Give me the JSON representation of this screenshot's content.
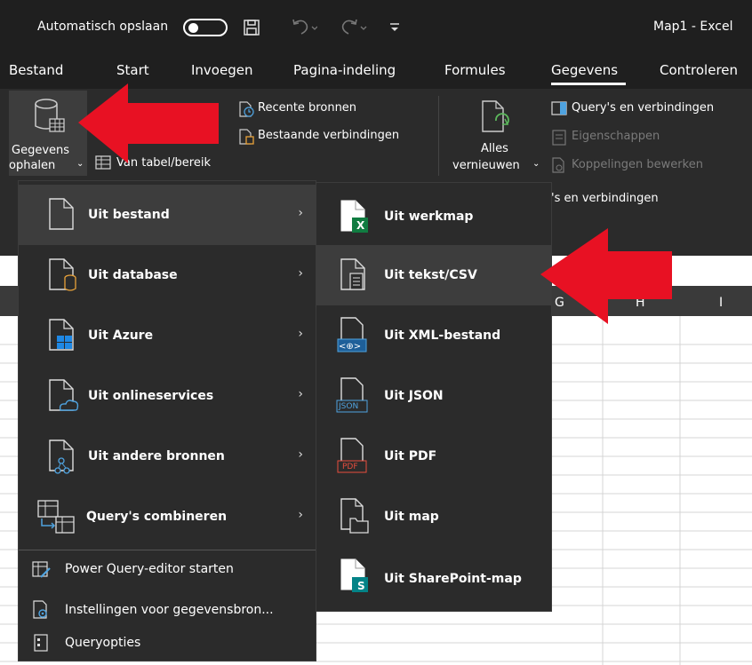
{
  "titlebar": {
    "autosave_label": "Automatisch opslaan",
    "title": "Map1  -  Excel",
    "undo_icon": "undo-icon",
    "redo_icon": "redo-icon",
    "save_icon": "save-icon"
  },
  "tabs": [
    "Bestand",
    "Start",
    "Invoegen",
    "Pagina-indeling",
    "Formules",
    "Gegevens",
    "Controleren"
  ],
  "active_tab": "Gegevens",
  "ribbon": {
    "get_data_line1": "Gegevens",
    "get_data_line2": "ophalen",
    "from_table": "Van tabel/bereik",
    "recent_sources": "Recente bronnen",
    "existing_connections": "Bestaande verbindingen",
    "refresh_all_line1": "Alles",
    "refresh_all_line2": "vernieuwen",
    "queries_connections": "Query's en verbindingen",
    "properties": "Eigenschappen",
    "edit_links": "Koppelingen bewerken",
    "group_queries": "'s en verbindingen"
  },
  "main_menu": [
    {
      "label": "Uit bestand",
      "accel": "b",
      "icon": "file-icon",
      "submenu": true
    },
    {
      "label": "Uit database",
      "accel": "d",
      "icon": "database-file-icon",
      "submenu": true
    },
    {
      "label": "Uit Azure",
      "accel": "A",
      "icon": "azure-file-icon",
      "submenu": true
    },
    {
      "label": "Uit onlineservices",
      "accel": "U",
      "icon": "cloud-file-icon",
      "submenu": true
    },
    {
      "label": "Uit andere bronnen",
      "accel": "a",
      "icon": "other-sources-icon",
      "submenu": true
    },
    {
      "label": "Query's combineren",
      "accel": "Q",
      "icon": "combine-queries-icon",
      "submenu": true
    }
  ],
  "main_menu_small": [
    {
      "label": "Power Query-editor starten",
      "accel": "P",
      "icon": "power-query-icon"
    },
    {
      "label": "Instellingen voor gegevensbron...",
      "accel": "I",
      "icon": "data-source-settings-icon"
    },
    {
      "label": "Queryopties",
      "accel": "s",
      "icon": "query-options-icon"
    }
  ],
  "sub_menu": [
    {
      "label": "Uit werkmap",
      "accel": "w",
      "icon": "excel-workbook-icon"
    },
    {
      "label": "Uit tekst/CSV",
      "accel": "t",
      "icon": "text-file-icon"
    },
    {
      "label": "Uit XML-bestand",
      "accel": "X",
      "icon": "xml-file-icon"
    },
    {
      "label": "Uit JSON",
      "accel": "J",
      "icon": "json-file-icon"
    },
    {
      "label": "Uit PDF",
      "accel": "U",
      "icon": "pdf-file-icon"
    },
    {
      "label": "Uit map",
      "accel": "m",
      "icon": "folder-icon"
    },
    {
      "label": "Uit SharePoint-map",
      "accel": "m",
      "icon": "sharepoint-folder-icon"
    }
  ],
  "icon_badges": {
    "xml": "<⊕>",
    "json": "JSON",
    "pdf": "PDF",
    "excel": "X",
    "sharepoint": "S"
  },
  "columns_visible": [
    "G",
    "H",
    "I"
  ],
  "colors": {
    "highlight_arrow": "#e81123",
    "excel_green": "#107c41",
    "sharepoint_teal": "#038387",
    "menu_bg": "#2b2b2b",
    "menu_hover": "#3d3d3d"
  }
}
